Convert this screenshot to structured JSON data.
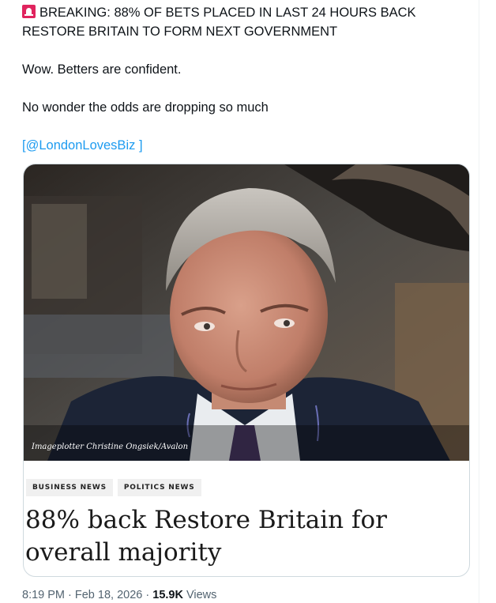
{
  "tweet": {
    "line1": "BREAKING: 88% OF BETS PLACED IN LAST 24 HOURS BACK",
    "line2": "RESTORE BRITAIN TO FORM NEXT GOVERNMENT",
    "line3": "Wow. Betters are confident.",
    "line4": "No wonder the odds are dropping so much",
    "link_open": "[",
    "link_text": "@LondonLovesBiz",
    "link_close": " ]",
    "icon": "siren-icon"
  },
  "card": {
    "photo_credit": "Imageplotter Christine Ongsiek/Avalon",
    "tags": [
      "BUSINESS NEWS",
      "POLITICS NEWS"
    ],
    "headline": "88% back Restore Britain for overall majority"
  },
  "meta": {
    "time": "8:19 PM",
    "sep1": " · ",
    "date": "Feb 18, 2026",
    "sep2": " · ",
    "views_count": "15.9K",
    "views_label": " Views"
  },
  "colors": {
    "link": "#1d9bf0",
    "muted": "#536471",
    "border": "#cfd9de",
    "siren": "#e0245e"
  }
}
